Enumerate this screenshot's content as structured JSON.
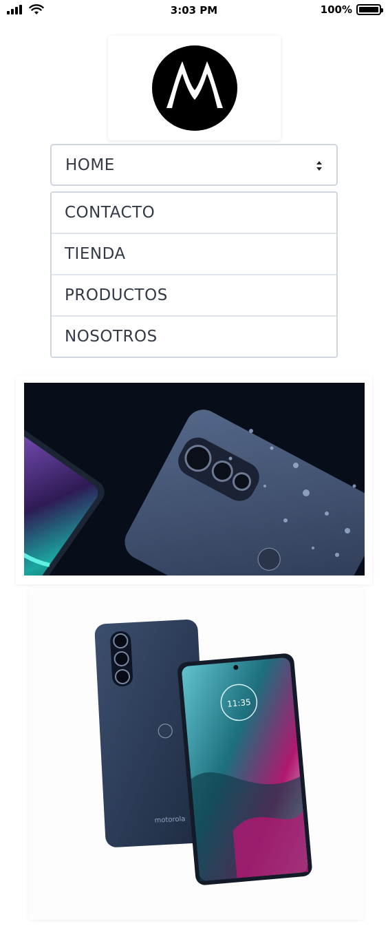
{
  "status_bar": {
    "time": "3:03 PM",
    "battery_percent": "100%",
    "battery_level": 1.0
  },
  "brand": {
    "logo_icon": "motorola-batwing-logo"
  },
  "nav": {
    "selected": "HOME",
    "options": [
      "CONTACTO",
      "TIENDA",
      "PRODUCTOS",
      "NOSOTROS"
    ]
  },
  "banner": {
    "image": "phone-water-droplets-banner"
  },
  "product": {
    "image": "motorola-edge-phone-front-back",
    "back_brand_text": "motorola",
    "screen_clock": "11:35"
  },
  "colors": {
    "select_border": "#cfd6df",
    "text": "#333a45",
    "banner_bg": "#070d19"
  }
}
